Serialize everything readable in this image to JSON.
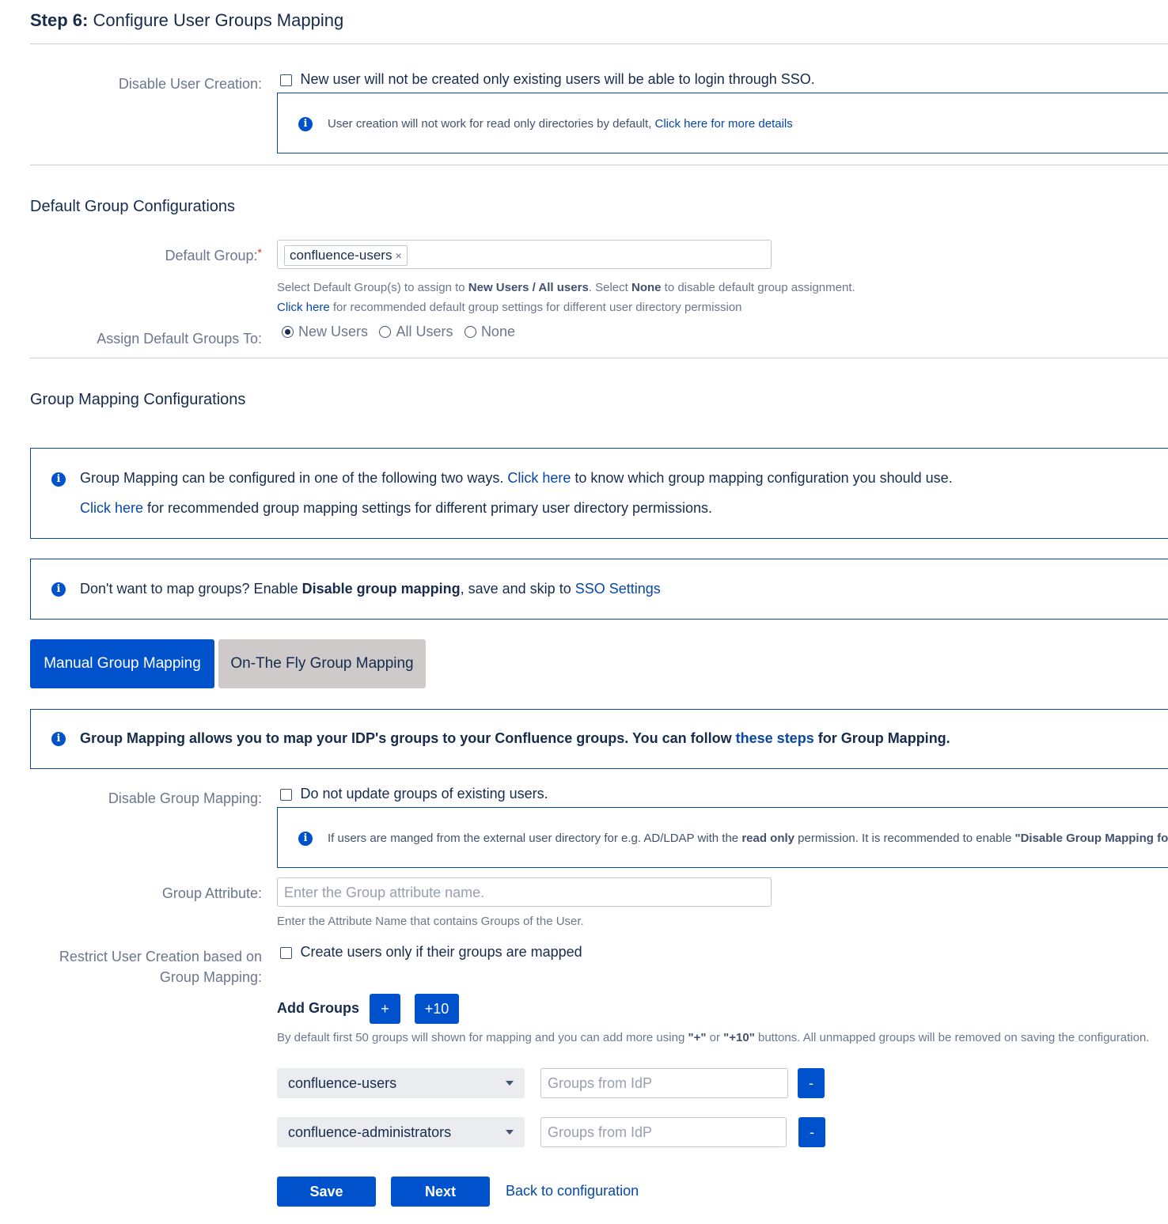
{
  "title": {
    "step": "Step 6:",
    "text": "Configure User Groups Mapping"
  },
  "disable_user_creation": {
    "label": "Disable User Creation:",
    "checkbox_text": "New user will not be created only existing users will be able to login through SSO.",
    "info": {
      "text": "User creation will not work for read only directories by default,",
      "link": "Click here for more details"
    }
  },
  "default_group_section": {
    "heading": "Default Group Configurations",
    "default_group_label": "Default Group:",
    "required_mark": "*",
    "chip": "confluence-users",
    "chip_remove": "×",
    "help1": {
      "a": "Select Default Group(s) to assign to ",
      "b": "New Users / All users",
      "c": ". Select ",
      "d": "None",
      "e": " to disable default group assignment."
    },
    "help2": {
      "link": "Click here",
      "text": " for recommended default group settings for different user directory permission"
    },
    "assign_label": "Assign Default Groups To:",
    "radios": [
      {
        "label": "New Users",
        "checked": true
      },
      {
        "label": "All Users",
        "checked": false
      },
      {
        "label": "None",
        "checked": false
      }
    ]
  },
  "group_mapping_section": {
    "heading": "Group Mapping Configurations",
    "info1": {
      "line1_a": "Group Mapping can be configured in one of the following two ways.",
      "line1_link": "Click here",
      "line1_b": "to know which group mapping configuration you should use.",
      "line2_link": "Click here",
      "line2_b": "for recommended group mapping settings for different primary user directory permissions."
    },
    "info2": {
      "a": "Don't want to map groups? Enable ",
      "b": "Disable group mapping",
      "c": ", save and skip to ",
      "link": "SSO Settings"
    },
    "tabs": [
      {
        "label": "Manual Group Mapping",
        "active": true
      },
      {
        "label": "On-The Fly Group Mapping",
        "active": false
      }
    ],
    "info3": {
      "a": "Group Mapping allows you to map your IDP's groups to your Confluence groups. You can follow ",
      "link": "these steps",
      "b": " for Group Mapping."
    },
    "disable_group_mapping": {
      "label": "Disable Group Mapping:",
      "checkbox_text": "Do not update groups of existing users.",
      "info": {
        "a": "If users are manged from the external user directory for e.g. AD/LDAP with the ",
        "b": "read only",
        "c": " permission. It is recommended to enable ",
        "d": "\"Disable Group Mapping for"
      }
    },
    "group_attribute": {
      "label": "Group Attribute:",
      "placeholder": "Enter the Group attribute name.",
      "help": "Enter the Attribute Name that contains Groups of the User."
    },
    "restrict": {
      "label": "Restrict User Creation based on Group Mapping:",
      "checkbox_text": "Create users only if their groups are mapped"
    },
    "add_groups": {
      "label": "Add Groups",
      "plus": "+",
      "plus10": "+10",
      "help_a": "By default first 50 groups will shown for mapping and you can add more using ",
      "help_b": "\"+\"",
      "help_c": " or ",
      "help_d": "\"+10\"",
      "help_e": " buttons. All unmapped groups will be removed on saving the configuration."
    },
    "mappings": [
      {
        "group": "confluence-users",
        "placeholder": "Groups from IdP",
        "remove": "-"
      },
      {
        "group": "confluence-administrators",
        "placeholder": "Groups from IdP",
        "remove": "-"
      }
    ]
  },
  "footer": {
    "save": "Save",
    "next": "Next",
    "back": "Back to configuration"
  }
}
